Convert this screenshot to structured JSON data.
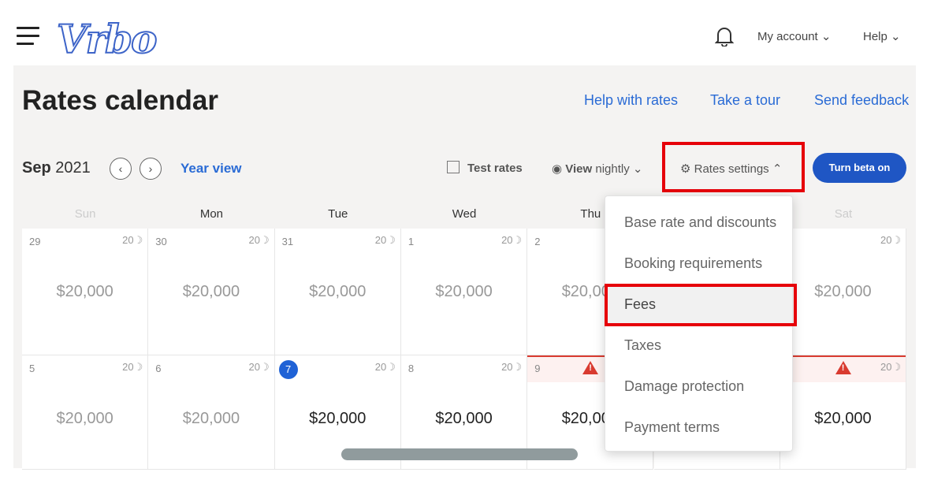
{
  "header": {
    "logo": "Vrbo",
    "my_account": "My account",
    "help": "Help"
  },
  "page": {
    "title": "Rates calendar",
    "links": [
      "Help with rates",
      "Take a tour",
      "Send feedback"
    ]
  },
  "toolbar": {
    "month": "Sep",
    "year": "2021",
    "year_view": "Year view",
    "test_rates": "Test rates",
    "view_bold": "View",
    "view_rest": "nightly",
    "rates_settings": "Rates settings",
    "beta": "Turn beta on"
  },
  "calendar": {
    "days": [
      "Sun",
      "Mon",
      "Tue",
      "Wed",
      "Thu",
      "Fri",
      "Sat"
    ],
    "weeks": [
      [
        {
          "d": "29",
          "n": "20",
          "p": "$20,000",
          "past": true
        },
        {
          "d": "30",
          "n": "20",
          "p": "$20,000",
          "past": true
        },
        {
          "d": "31",
          "n": "20",
          "p": "$20,000",
          "past": true
        },
        {
          "d": "1",
          "n": "20",
          "p": "$20,000",
          "past": true
        },
        {
          "d": "2",
          "n": "",
          "p": "$20,000",
          "past": true
        },
        {
          "d": "",
          "n": "",
          "p": "",
          "past": true
        },
        {
          "d": "",
          "n": "20",
          "p": "$20,000",
          "past": true
        }
      ],
      [
        {
          "d": "5",
          "n": "20",
          "p": "$20,000",
          "past": true
        },
        {
          "d": "6",
          "n": "20",
          "p": "$20,000",
          "past": true
        },
        {
          "d": "7",
          "n": "20",
          "p": "$20,000",
          "today": true
        },
        {
          "d": "8",
          "n": "20",
          "p": "$20,000"
        },
        {
          "d": "9",
          "n": "",
          "p": "$20,000",
          "warn": true
        },
        {
          "d": "",
          "n": "",
          "p": ""
        },
        {
          "d": "1",
          "n": "20",
          "p": "$20,000",
          "warn": true
        }
      ]
    ]
  },
  "rates_menu": {
    "items": [
      "Base rate and discounts",
      "Booking requirements",
      "Fees",
      "Taxes",
      "Damage protection",
      "Payment terms"
    ],
    "highlighted": "Fees"
  },
  "colors": {
    "accent": "#2a6bd5",
    "highlight_box": "#e6000a",
    "warning": "#d93b30"
  }
}
